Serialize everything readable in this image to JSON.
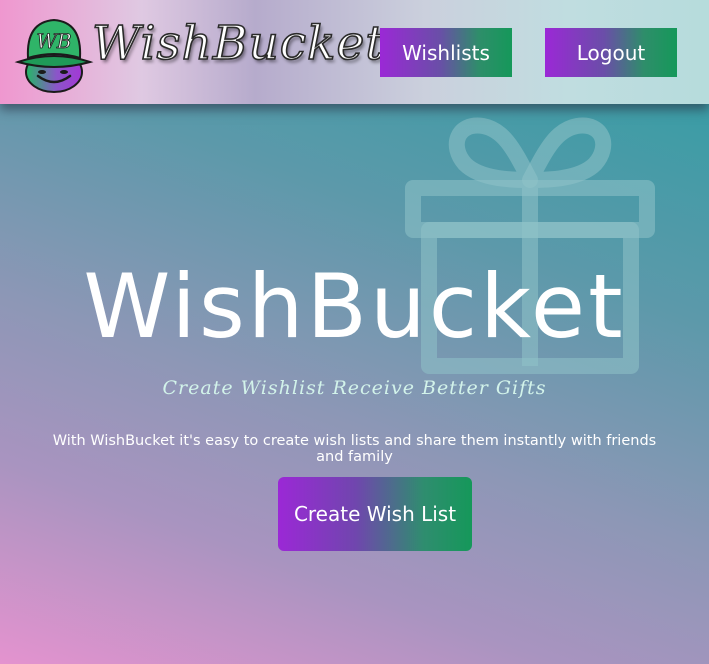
{
  "header": {
    "brand": "WishBucket",
    "logo_monogram": "WB",
    "nav": {
      "wishlists_label": "Wishlists",
      "logout_label": "Logout"
    }
  },
  "hero": {
    "title": "WishBucket",
    "tagline": "Create Wishlist Receive Better Gifts",
    "description": "With WishBucket it's easy to create wish lists and share them instantly with friends and family",
    "cta_label": "Create Wish List",
    "background_icon": "gift-icon"
  },
  "colors": {
    "button_gradient_start": "#9b28d6",
    "button_gradient_end": "#15985a",
    "tagline": "#d2f3ea",
    "text": "#ffffff"
  }
}
